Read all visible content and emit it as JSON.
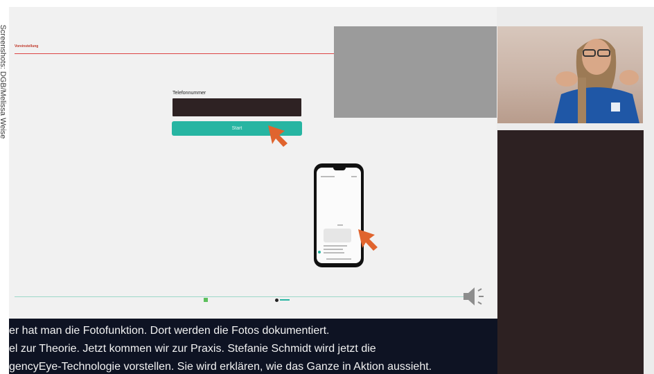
{
  "credit": "Screenshots: DGB/Melissa Weise",
  "web_app": {
    "header_label": "Voreinstellung",
    "phone_field_label": "Telefonnummer",
    "phone_field_value": "",
    "start_button_label": "Start"
  },
  "subtitles": [
    "er hat man die Fotofunktion. Dort werden die Fotos dokumentiert.",
    "el zur Theorie. Jetzt kommen wir zur Praxis. Stefanie Schmidt wird jetzt die",
    "gencyEye-Technologie vorstellen. Sie wird erklären, wie das Ganze in Aktion aussieht."
  ],
  "colors": {
    "accent_teal": "#27b5a2",
    "arrow_orange": "#e0642e",
    "subtitle_bg": "#0e1323",
    "dark_panel": "#2d2122"
  },
  "icons": [
    "speaker-icon",
    "arrow-pointer-icon"
  ]
}
